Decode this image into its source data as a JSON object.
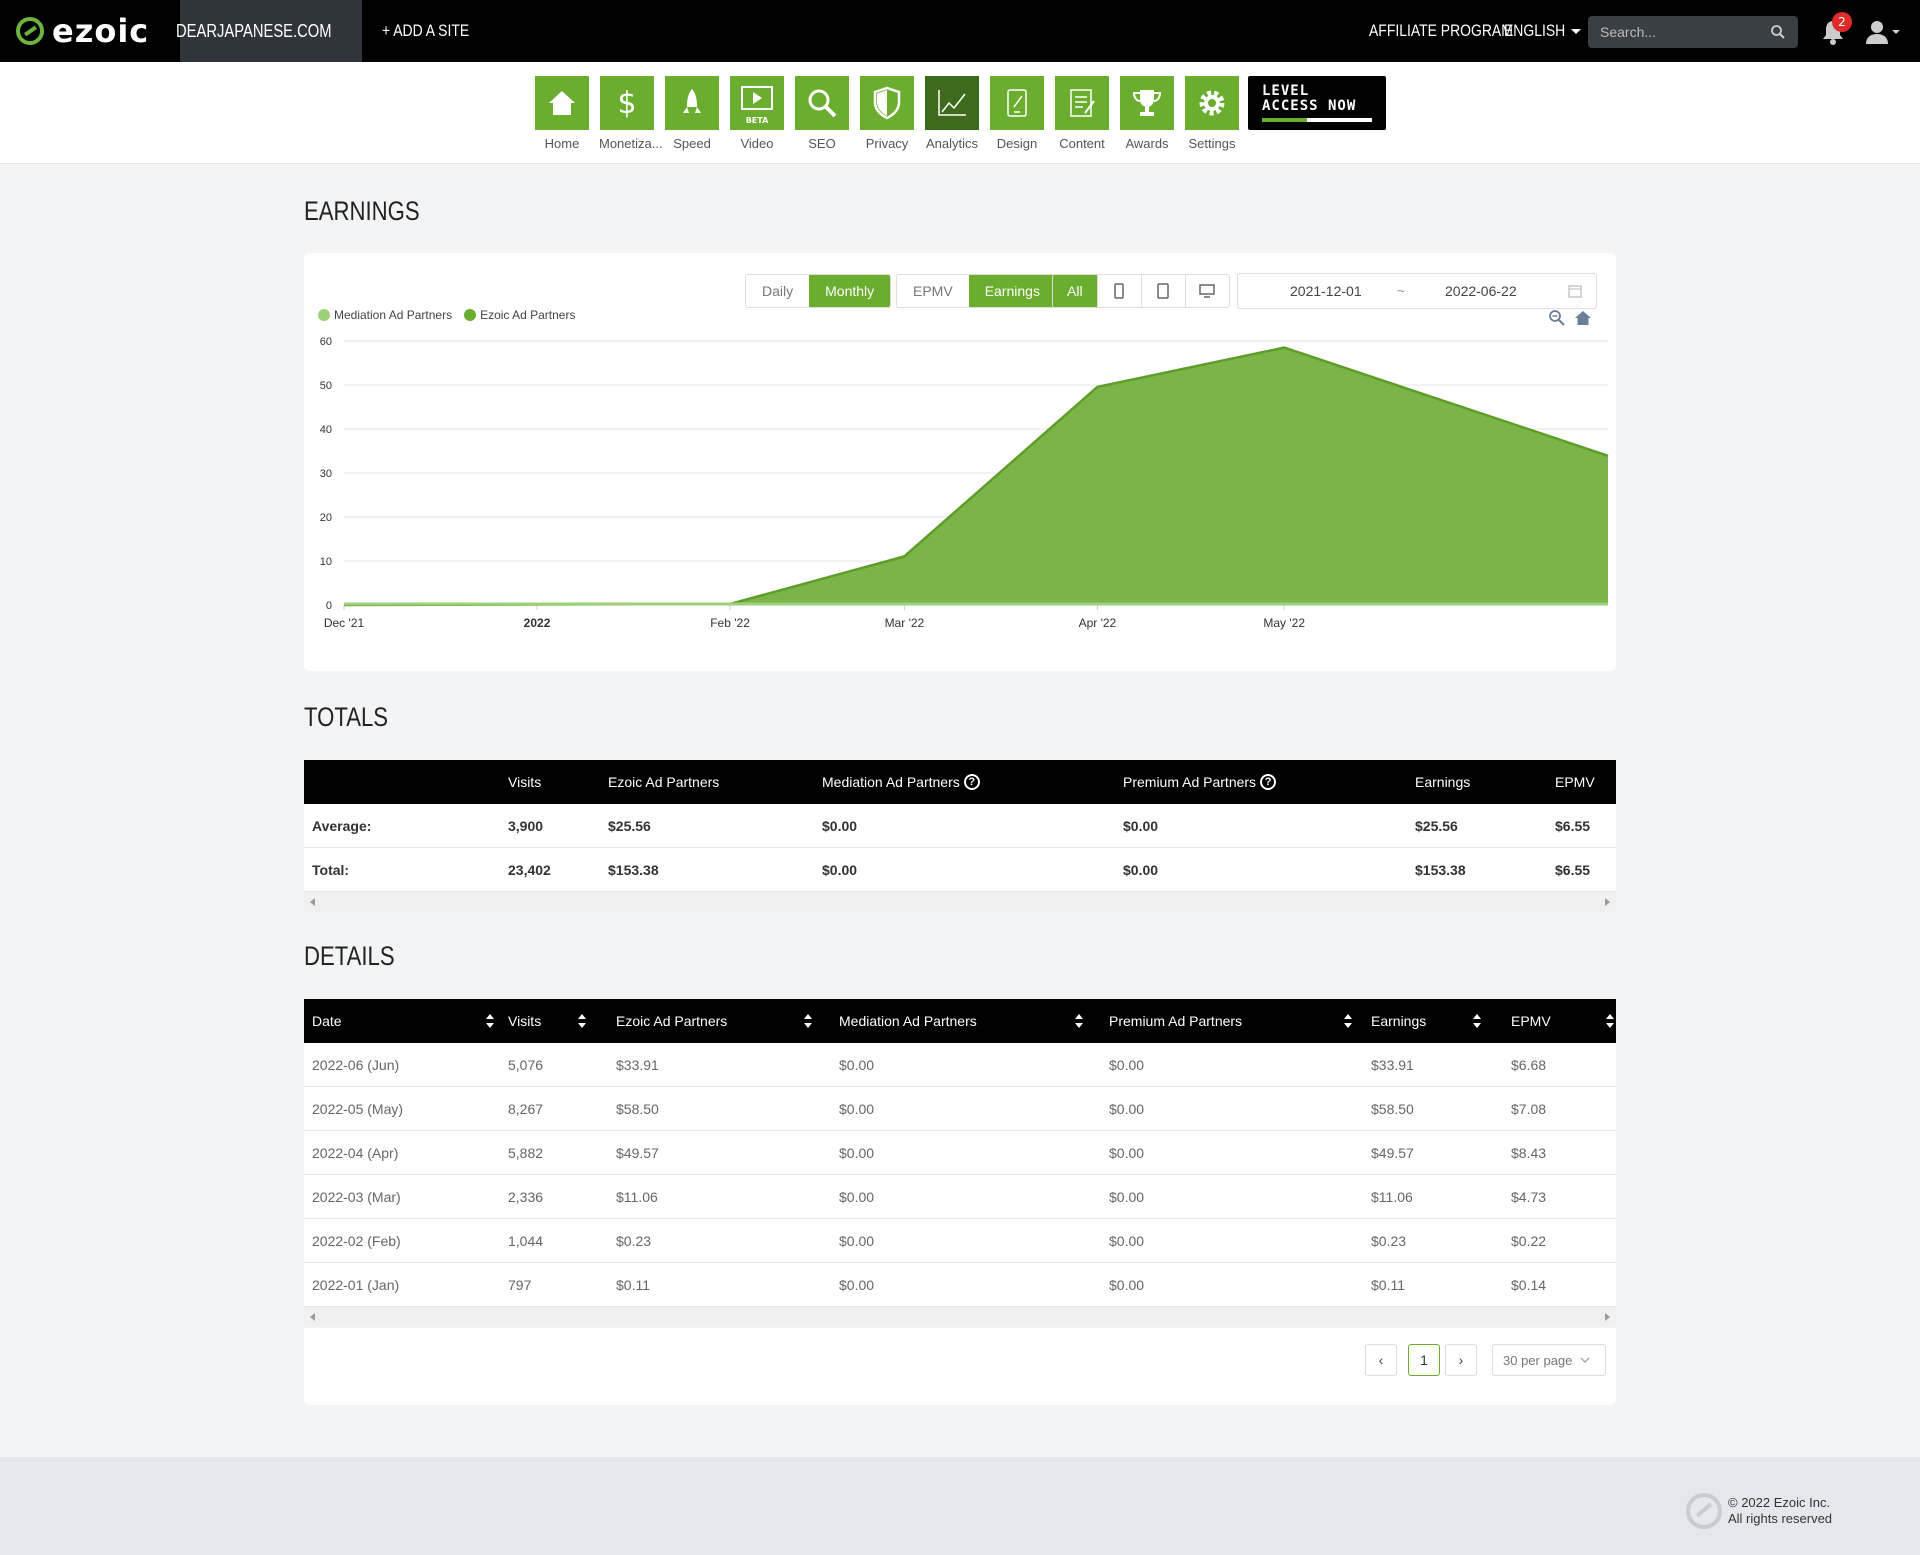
{
  "topbar": {
    "logo": "ezoic",
    "site": "DEARJAPANESE.COM",
    "add_site": "+ ADD A SITE",
    "affiliate": "AFFILIATE PROGRAM",
    "language": "ENGLISH",
    "search_placeholder": "Search...",
    "notifications": "2"
  },
  "nav": [
    {
      "label": "Home",
      "icon": "home-icon"
    },
    {
      "label": "Monetiza...",
      "icon": "dollar-icon"
    },
    {
      "label": "Speed",
      "icon": "rocket-icon"
    },
    {
      "label": "Video",
      "icon": "video-icon",
      "badge": "BETA"
    },
    {
      "label": "SEO",
      "icon": "magnifier-icon"
    },
    {
      "label": "Privacy",
      "icon": "shield-icon"
    },
    {
      "label": "Analytics",
      "icon": "line-chart-icon",
      "active": true
    },
    {
      "label": "Design",
      "icon": "design-icon"
    },
    {
      "label": "Content",
      "icon": "content-icon"
    },
    {
      "label": "Awards",
      "icon": "trophy-icon"
    },
    {
      "label": "Settings",
      "icon": "gear-icon"
    }
  ],
  "level_banner": {
    "line1": "LEVEL",
    "line2": "ACCESS NOW"
  },
  "earnings": {
    "title": "EARNINGS",
    "period_buttons": [
      "Daily",
      "Monthly"
    ],
    "metric_buttons": [
      "EPMV",
      "Earnings"
    ],
    "device_all": "All",
    "date_from": "2021-12-01",
    "date_sep": "~",
    "date_to": "2022-06-22",
    "legend": [
      {
        "name": "Mediation Ad Partners",
        "color": "#9dd07a"
      },
      {
        "name": "Ezoic Ad Partners",
        "color": "#6aad2f"
      }
    ]
  },
  "chart_data": {
    "type": "area",
    "x": [
      "2021-12-01",
      "2022-01-01",
      "2022-02-01",
      "2022-03-01",
      "2022-04-01",
      "2022-05-01",
      "2022-06-22"
    ],
    "x_tick_labels": [
      "Dec '21",
      "2022",
      "Feb '22",
      "Mar '22",
      "Apr '22",
      "May '22"
    ],
    "series": [
      {
        "name": "Mediation Ad Partners",
        "values": [
          0,
          0,
          0,
          0,
          0,
          0,
          0
        ]
      },
      {
        "name": "Ezoic Ad Partners",
        "values": [
          0,
          0.11,
          0.23,
          11.06,
          49.57,
          58.5,
          33.91
        ]
      }
    ],
    "yticks": [
      0,
      10,
      20,
      30,
      40,
      50,
      60
    ],
    "ylim": [
      0,
      60
    ],
    "grid": true,
    "legend_position": "top-left"
  },
  "totals": {
    "title": "TOTALS",
    "headers": [
      "",
      "Visits",
      "Ezoic Ad Partners",
      "Mediation Ad Partners",
      "Premium Ad Partners",
      "Earnings",
      "EPMV"
    ],
    "help_icon": "?",
    "rows": [
      [
        "Average:",
        "3,900",
        "$25.56",
        "$0.00",
        "$0.00",
        "$25.56",
        "$6.55"
      ],
      [
        "Total:",
        "23,402",
        "$153.38",
        "$0.00",
        "$0.00",
        "$153.38",
        "$6.55"
      ]
    ]
  },
  "details": {
    "title": "DETAILS",
    "headers": [
      "Date",
      "Visits",
      "Ezoic Ad Partners",
      "Mediation Ad Partners",
      "Premium Ad Partners",
      "Earnings",
      "EPMV"
    ],
    "rows": [
      [
        "2022-06 (Jun)",
        "5,076",
        "$33.91",
        "$0.00",
        "$0.00",
        "$33.91",
        "$6.68"
      ],
      [
        "2022-05 (May)",
        "8,267",
        "$58.50",
        "$0.00",
        "$0.00",
        "$58.50",
        "$7.08"
      ],
      [
        "2022-04 (Apr)",
        "5,882",
        "$49.57",
        "$0.00",
        "$0.00",
        "$49.57",
        "$8.43"
      ],
      [
        "2022-03 (Mar)",
        "2,336",
        "$11.06",
        "$0.00",
        "$0.00",
        "$11.06",
        "$4.73"
      ],
      [
        "2022-02 (Feb)",
        "1,044",
        "$0.23",
        "$0.00",
        "$0.00",
        "$0.23",
        "$0.22"
      ],
      [
        "2022-01 (Jan)",
        "797",
        "$0.11",
        "$0.00",
        "$0.00",
        "$0.11",
        "$0.14"
      ]
    ]
  },
  "pager": {
    "prev": "‹",
    "page": "1",
    "next": "›",
    "per_page": "30 per page"
  },
  "footer": {
    "line1": "© 2022 Ezoic Inc.",
    "line2": "All rights reserved"
  }
}
